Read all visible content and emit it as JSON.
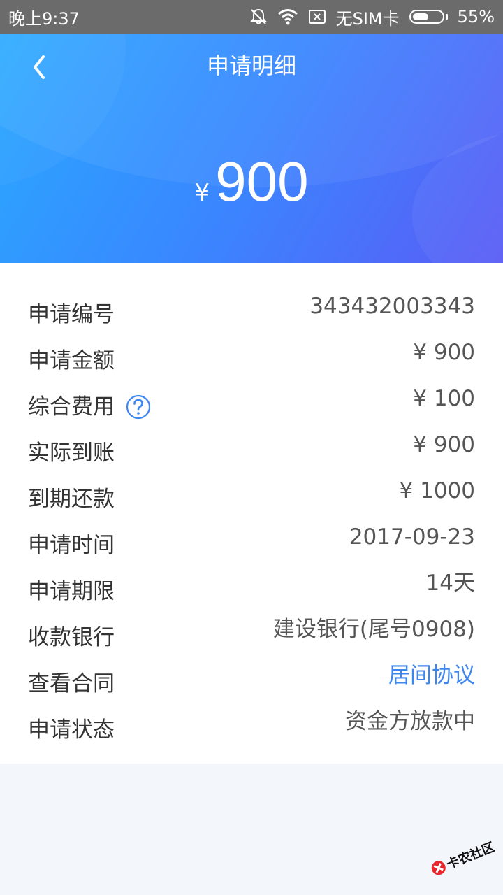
{
  "status_bar": {
    "time": "晚上9:37",
    "sim": "无SIM卡",
    "battery": "55%",
    "battery_level": 0.55,
    "icons": [
      "bell-off-icon",
      "wifi-icon",
      "no-sim-icon",
      "battery-icon"
    ]
  },
  "header": {
    "title": "申请明细",
    "back_icon": "chevron-left-icon",
    "currency_symbol": "¥",
    "amount": "900"
  },
  "details": {
    "rows": [
      {
        "label": "申请编号",
        "value": "343432003343"
      },
      {
        "label": "申请金额",
        "value": "¥ 900"
      },
      {
        "label": "综合费用",
        "value": "¥ 100",
        "help_icon": "question-circle-icon"
      },
      {
        "label": "实际到账",
        "value": "¥ 900"
      },
      {
        "label": "到期还款",
        "value": "¥ 1000"
      },
      {
        "label": "申请时间",
        "value": "2017-09-23"
      },
      {
        "label": "申请期限",
        "value": "14天"
      },
      {
        "label": "收款银行",
        "value": "建设银行(尾号0908)"
      },
      {
        "label": "查看合同",
        "value": "居间协议",
        "link": true
      },
      {
        "label": "申请状态",
        "value": "资金方放款中"
      }
    ]
  },
  "watermark": {
    "text": "卡农社区"
  },
  "colors": {
    "status_bar": "#6b6b6b",
    "header_start": "#29a9ff",
    "header_end": "#5a5cf5",
    "link": "#3d86f0",
    "label": "#333333",
    "value": "#555555",
    "page_bg": "#f3f6fb"
  }
}
